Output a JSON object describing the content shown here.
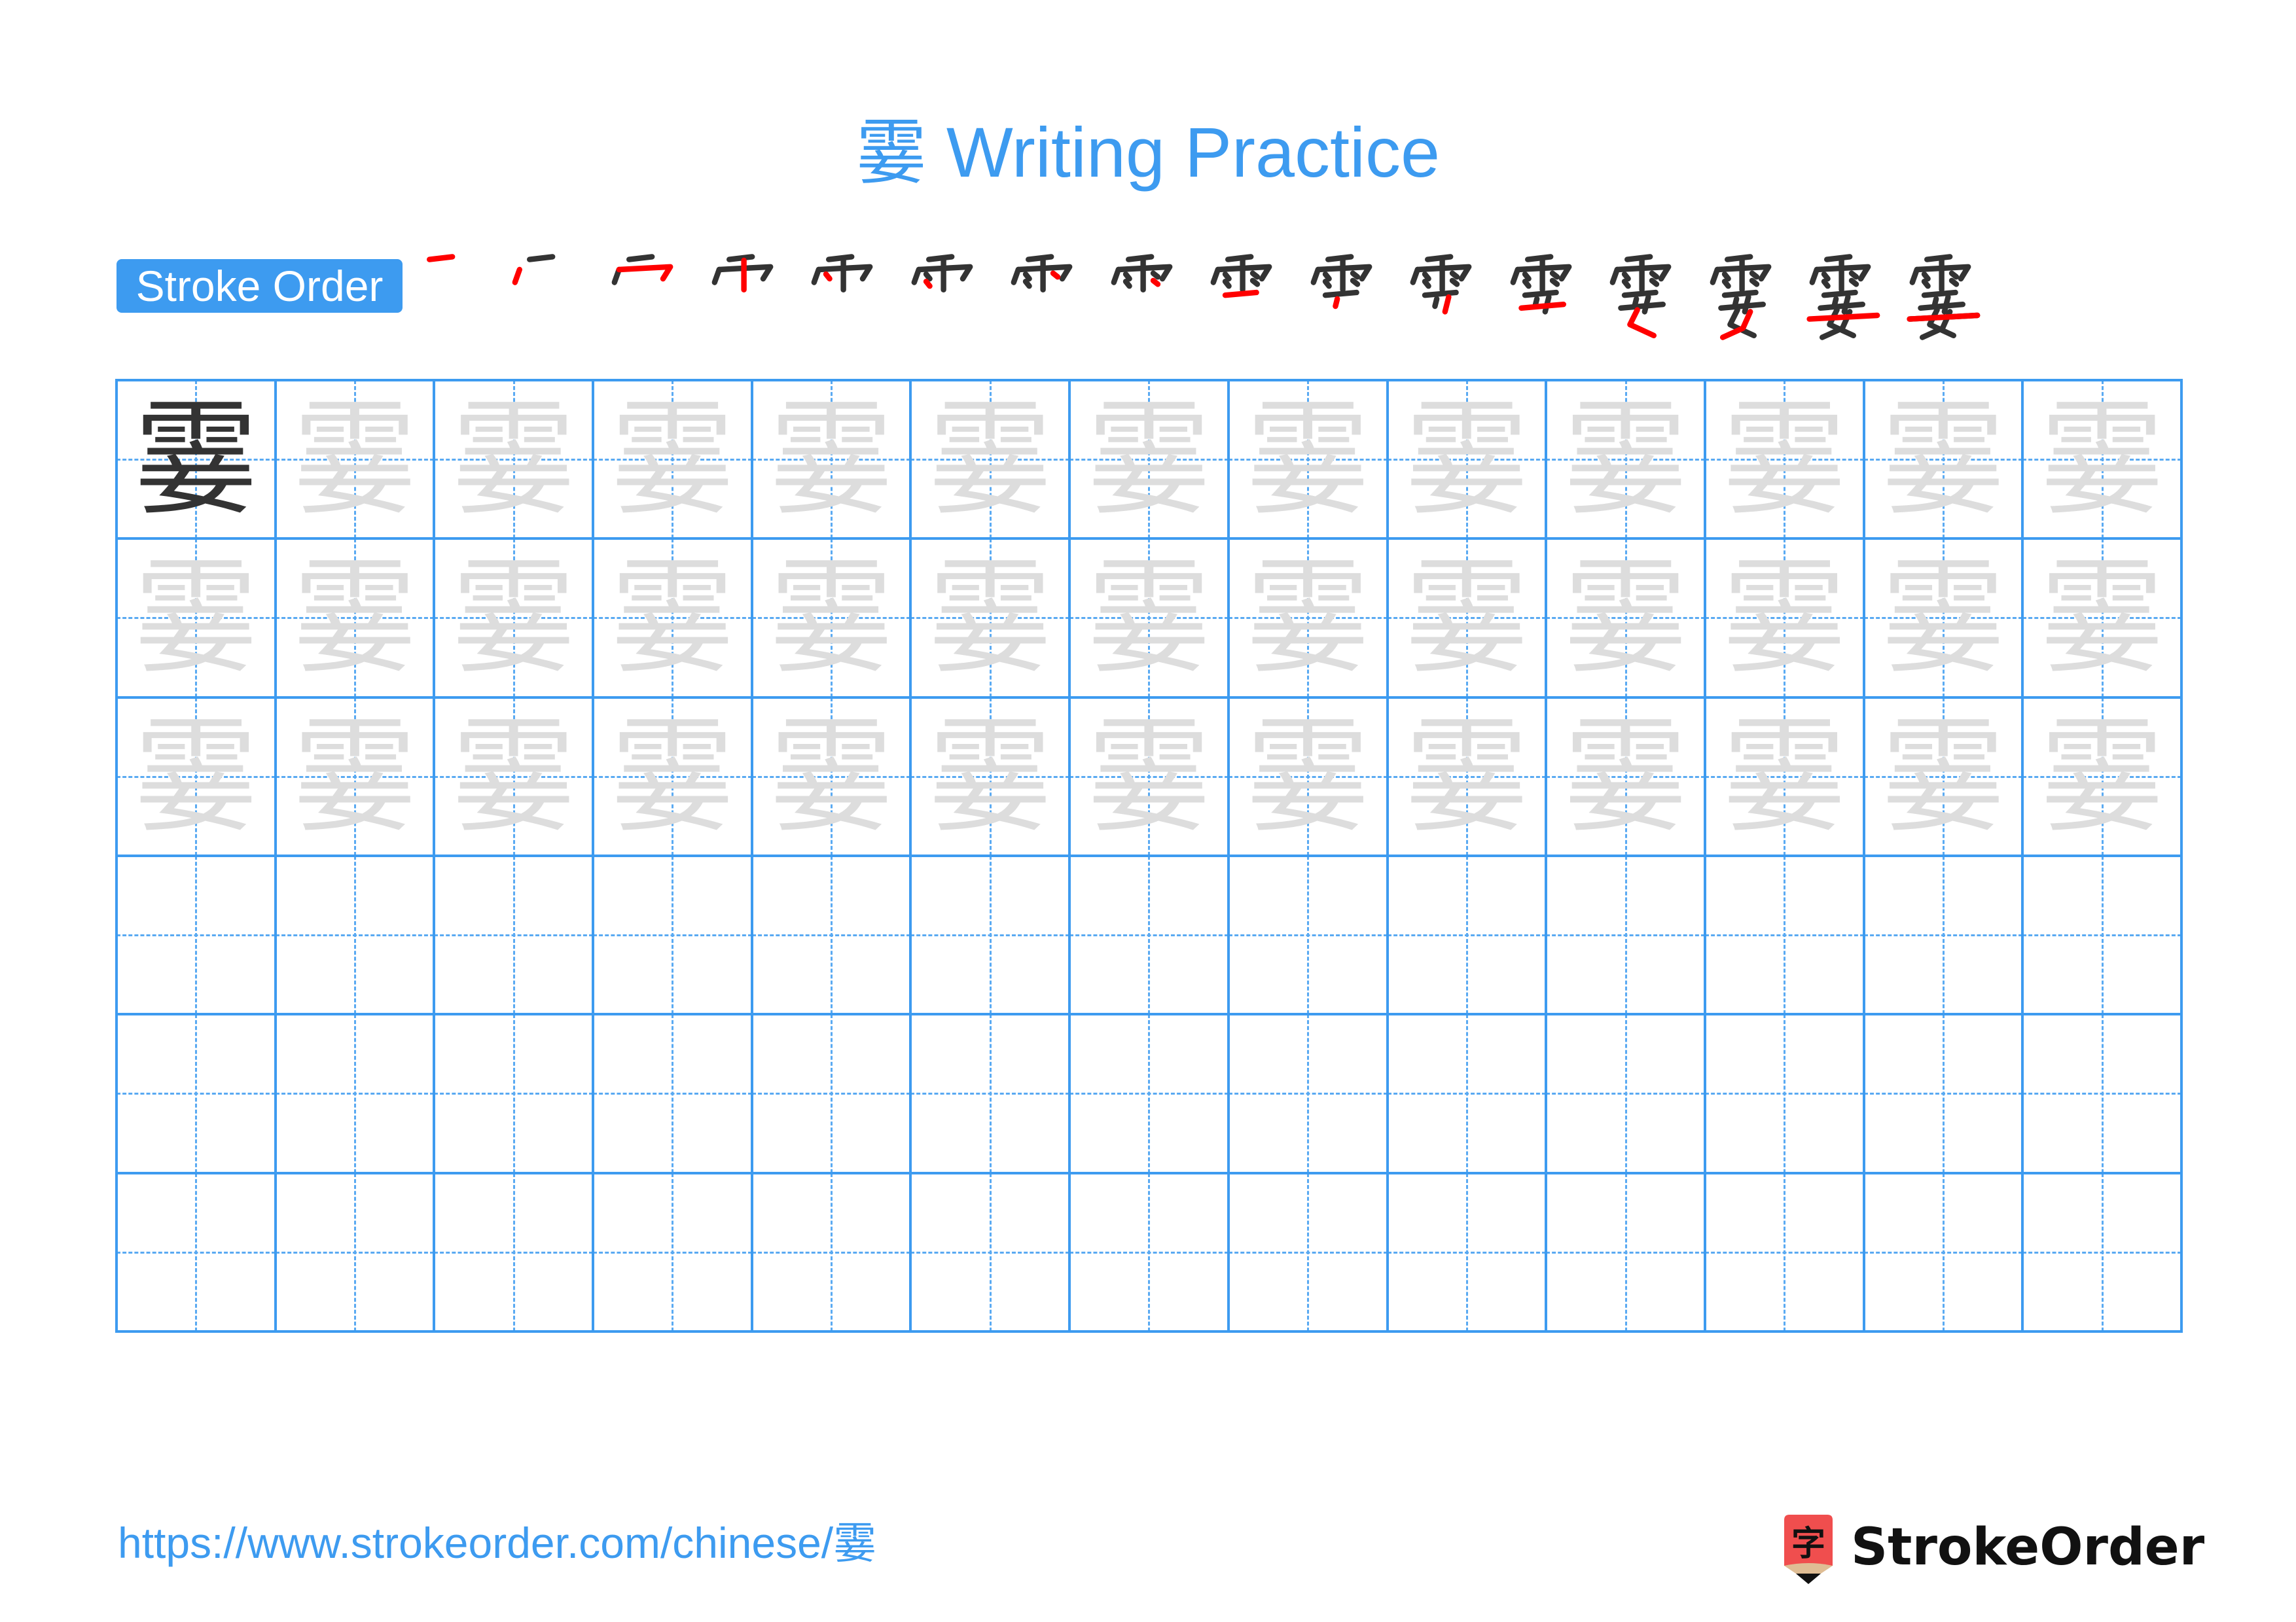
{
  "page": {
    "character": "霎",
    "title": "霎 Writing Practice",
    "stroke_order_label": "Stroke Order",
    "stroke_count": 16,
    "footer_url": "https://www.strokeorder.com/chinese/霎",
    "brand_name": "StrokeOrder",
    "brand_icon_char": "字"
  },
  "colors": {
    "accent": "#3d9bf0",
    "model_char": "#333333",
    "trace_char": "#dddddd",
    "current_stroke": "#ff0000",
    "previous_strokes": "#333333",
    "logo_red": "#f04e4e",
    "logo_tan": "#dfbd94"
  },
  "grid": {
    "rows": 6,
    "cols": 13,
    "model_cells": 1,
    "trace_rows": 3
  },
  "stroke_steps": [
    {
      "step": 1
    },
    {
      "step": 2
    },
    {
      "step": 3
    },
    {
      "step": 4
    },
    {
      "step": 5
    },
    {
      "step": 6
    },
    {
      "step": 7
    },
    {
      "step": 8
    },
    {
      "step": 9
    },
    {
      "step": 10
    },
    {
      "step": 11
    },
    {
      "step": 12
    },
    {
      "step": 13
    },
    {
      "step": 14
    },
    {
      "step": 15
    },
    {
      "step": 16
    }
  ]
}
